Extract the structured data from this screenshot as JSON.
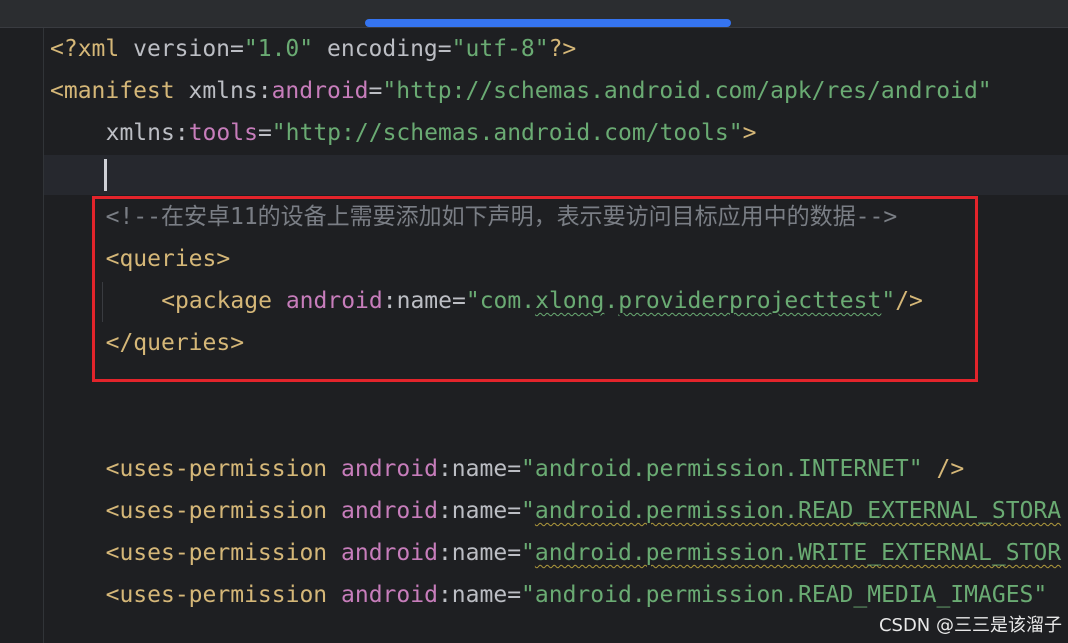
{
  "code_lines": [
    {
      "indent": "",
      "tokens": [
        {
          "text": "<?xml ",
          "cls": "t"
        },
        {
          "text": "version",
          "cls": "a"
        },
        {
          "text": "=",
          "cls": "p"
        },
        {
          "text": "\"1.0\"",
          "cls": "v"
        },
        {
          "text": " ",
          "cls": "p"
        },
        {
          "text": "encoding",
          "cls": "a"
        },
        {
          "text": "=",
          "cls": "p"
        },
        {
          "text": "\"utf-8\"",
          "cls": "v"
        },
        {
          "text": "?>",
          "cls": "t"
        }
      ]
    },
    {
      "indent": "",
      "tokens": [
        {
          "text": "<manifest ",
          "cls": "t"
        },
        {
          "text": "xmlns:",
          "cls": "a"
        },
        {
          "text": "android",
          "cls": "ns"
        },
        {
          "text": "=",
          "cls": "p"
        },
        {
          "text": "\"http://schemas.android.com/apk/res/android\"",
          "cls": "v"
        }
      ]
    },
    {
      "indent": "    ",
      "tokens": [
        {
          "text": "xmlns:",
          "cls": "a"
        },
        {
          "text": "tools",
          "cls": "ns"
        },
        {
          "text": "=",
          "cls": "p"
        },
        {
          "text": "\"http://schemas.android.com/tools\"",
          "cls": "v"
        },
        {
          "text": ">",
          "cls": "t"
        }
      ]
    },
    {
      "indent": "",
      "tokens": []
    },
    {
      "indent": "    ",
      "tokens": [
        {
          "text": "<!--在安卓11的设备上需要添加如下声明，表示要访问目标应用中的数据-->",
          "cls": "c"
        }
      ]
    },
    {
      "indent": "    ",
      "tokens": [
        {
          "text": "<queries>",
          "cls": "t"
        }
      ]
    },
    {
      "indent": "        ",
      "tokens": [
        {
          "text": "<package ",
          "cls": "t"
        },
        {
          "text": "android",
          "cls": "ns"
        },
        {
          "text": ":name",
          "cls": "a"
        },
        {
          "text": "=",
          "cls": "p"
        },
        {
          "text": "\"com.",
          "cls": "v"
        },
        {
          "text": "xlong",
          "cls": "v wavy"
        },
        {
          "text": ".",
          "cls": "v"
        },
        {
          "text": "providerprojecttest",
          "cls": "v wavy"
        },
        {
          "text": "\"",
          "cls": "v"
        },
        {
          "text": "/>",
          "cls": "t"
        }
      ]
    },
    {
      "indent": "    ",
      "tokens": [
        {
          "text": "</queries>",
          "cls": "t"
        }
      ]
    },
    {
      "indent": "",
      "tokens": []
    },
    {
      "indent": "",
      "tokens": []
    },
    {
      "indent": "    ",
      "tokens": [
        {
          "text": "<uses-permission ",
          "cls": "t"
        },
        {
          "text": "android",
          "cls": "ns"
        },
        {
          "text": ":name",
          "cls": "a"
        },
        {
          "text": "=",
          "cls": "p"
        },
        {
          "text": "\"android.permission.INTERNET\"",
          "cls": "v"
        },
        {
          "text": " />",
          "cls": "t"
        }
      ]
    },
    {
      "indent": "    ",
      "tokens": [
        {
          "text": "<uses-permission ",
          "cls": "t"
        },
        {
          "text": "android",
          "cls": "ns"
        },
        {
          "text": ":name",
          "cls": "a"
        },
        {
          "text": "=",
          "cls": "p"
        },
        {
          "text": "\"",
          "cls": "v"
        },
        {
          "text": "android.permission.READ_EXTERNAL_STORA",
          "cls": "v wavy-y"
        }
      ]
    },
    {
      "indent": "    ",
      "tokens": [
        {
          "text": "<uses-permission ",
          "cls": "t"
        },
        {
          "text": "android",
          "cls": "ns"
        },
        {
          "text": ":name",
          "cls": "a"
        },
        {
          "text": "=",
          "cls": "p"
        },
        {
          "text": "\"",
          "cls": "v"
        },
        {
          "text": "android.permission.WRITE_EXTERNAL_STOR",
          "cls": "v wavy-y"
        }
      ]
    },
    {
      "indent": "    ",
      "tokens": [
        {
          "text": "<uses-permission ",
          "cls": "t"
        },
        {
          "text": "android",
          "cls": "ns"
        },
        {
          "text": ":name",
          "cls": "a"
        },
        {
          "text": "=",
          "cls": "p"
        },
        {
          "text": "\"android.permission.READ_MEDIA_IMAGES\"",
          "cls": "v"
        }
      ]
    }
  ],
  "watermark": "CSDN @三三是该溜子",
  "colors": {
    "background": "#1e1f22",
    "tag": "#d5b778",
    "attribute": "#bcbec4",
    "namespace": "#c77dbb",
    "string": "#6aab73",
    "comment": "#7a7e85",
    "highlight_box": "#e3242b",
    "active_tab_indicator": "#3574f0"
  }
}
